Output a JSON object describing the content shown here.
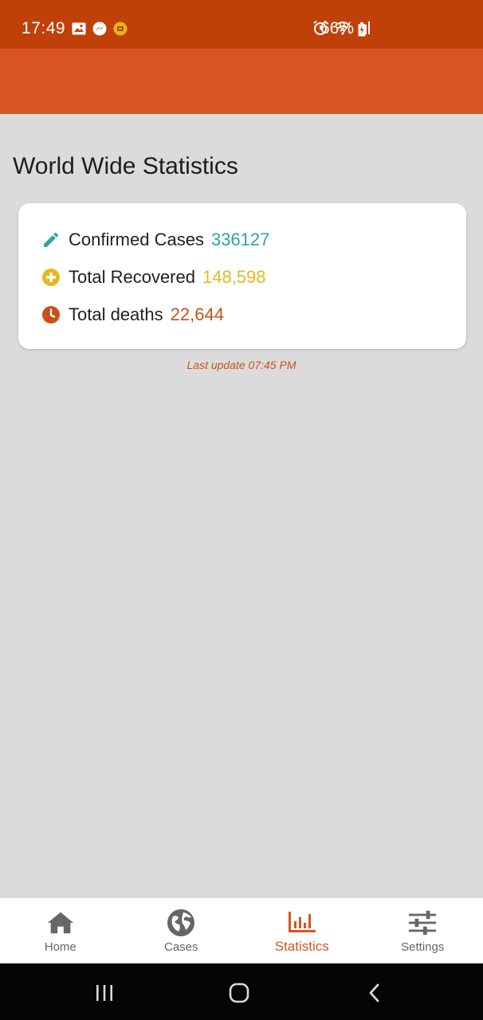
{
  "status": {
    "time": "17:49",
    "battery": "66%",
    "icons": [
      "gallery-icon",
      "messenger-icon",
      "app-notification-icon",
      "alarm-icon",
      "wifi-icon",
      "signal-icon",
      "battery-icon"
    ]
  },
  "page": {
    "title": "World Wide Statistics"
  },
  "stats": [
    {
      "label": "Confirmed Cases",
      "value": "336127",
      "icon": "pencil-icon",
      "color": "#2aa6a0"
    },
    {
      "label": "Total Recovered",
      "value": "148,598",
      "icon": "plus-circle-icon",
      "color": "#e6b820"
    },
    {
      "label": "Total deaths",
      "value": "22,644",
      "icon": "clock-icon",
      "color": "#c9501b"
    }
  ],
  "last_update": "Last update 07:45 PM",
  "nav": {
    "items": [
      {
        "label": "Home",
        "icon": "home-icon"
      },
      {
        "label": "Cases",
        "icon": "globe-icon"
      },
      {
        "label": "Statistics",
        "icon": "bar-chart-icon",
        "active": true
      },
      {
        "label": "Settings",
        "icon": "sliders-icon"
      }
    ]
  },
  "colors": {
    "status_bar": "#c0400a",
    "app_bar": "#d65520",
    "accent": "#d65520",
    "background": "#dbdbdb"
  }
}
